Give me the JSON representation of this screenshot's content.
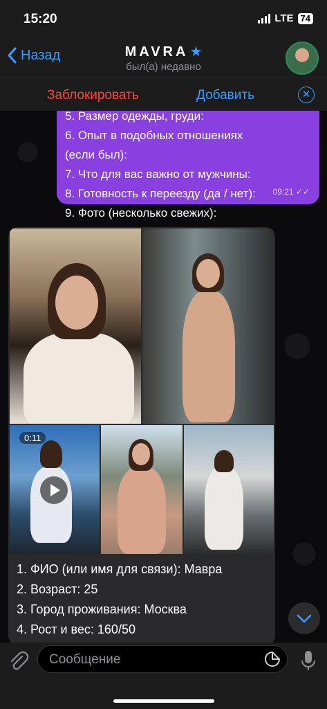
{
  "status": {
    "time": "15:20",
    "network": "LTE",
    "battery": "74"
  },
  "header": {
    "back_label": "Назад",
    "title": "MAVRA",
    "subtitle": "был(а) недавно"
  },
  "actions": {
    "block_label": "Заблокировать",
    "add_label": "Добавить"
  },
  "messages": {
    "outgoing": {
      "lines": [
        "5. Размер одежды, груди:",
        "6. Опыт в подобных отношениях",
        "(если был):",
        "7. Что для вас важно от мужчины:",
        "8. Готовность к переезду (да / нет):",
        "9.  Фото (несколько свежих):"
      ],
      "time": "09:21"
    },
    "incoming": {
      "video_duration": "0:11",
      "caption": [
        "1. ФИО (или имя для связи): Мавра",
        "2. Возраст: 25",
        "3. Город проживания: Москва",
        "4. Рост и вес: 160/50"
      ]
    }
  },
  "input": {
    "placeholder": "Сообщение"
  },
  "colors": {
    "accent": "#3e9bff",
    "outgoing_bubble": "#8a3fe0",
    "danger": "#ff453a"
  }
}
